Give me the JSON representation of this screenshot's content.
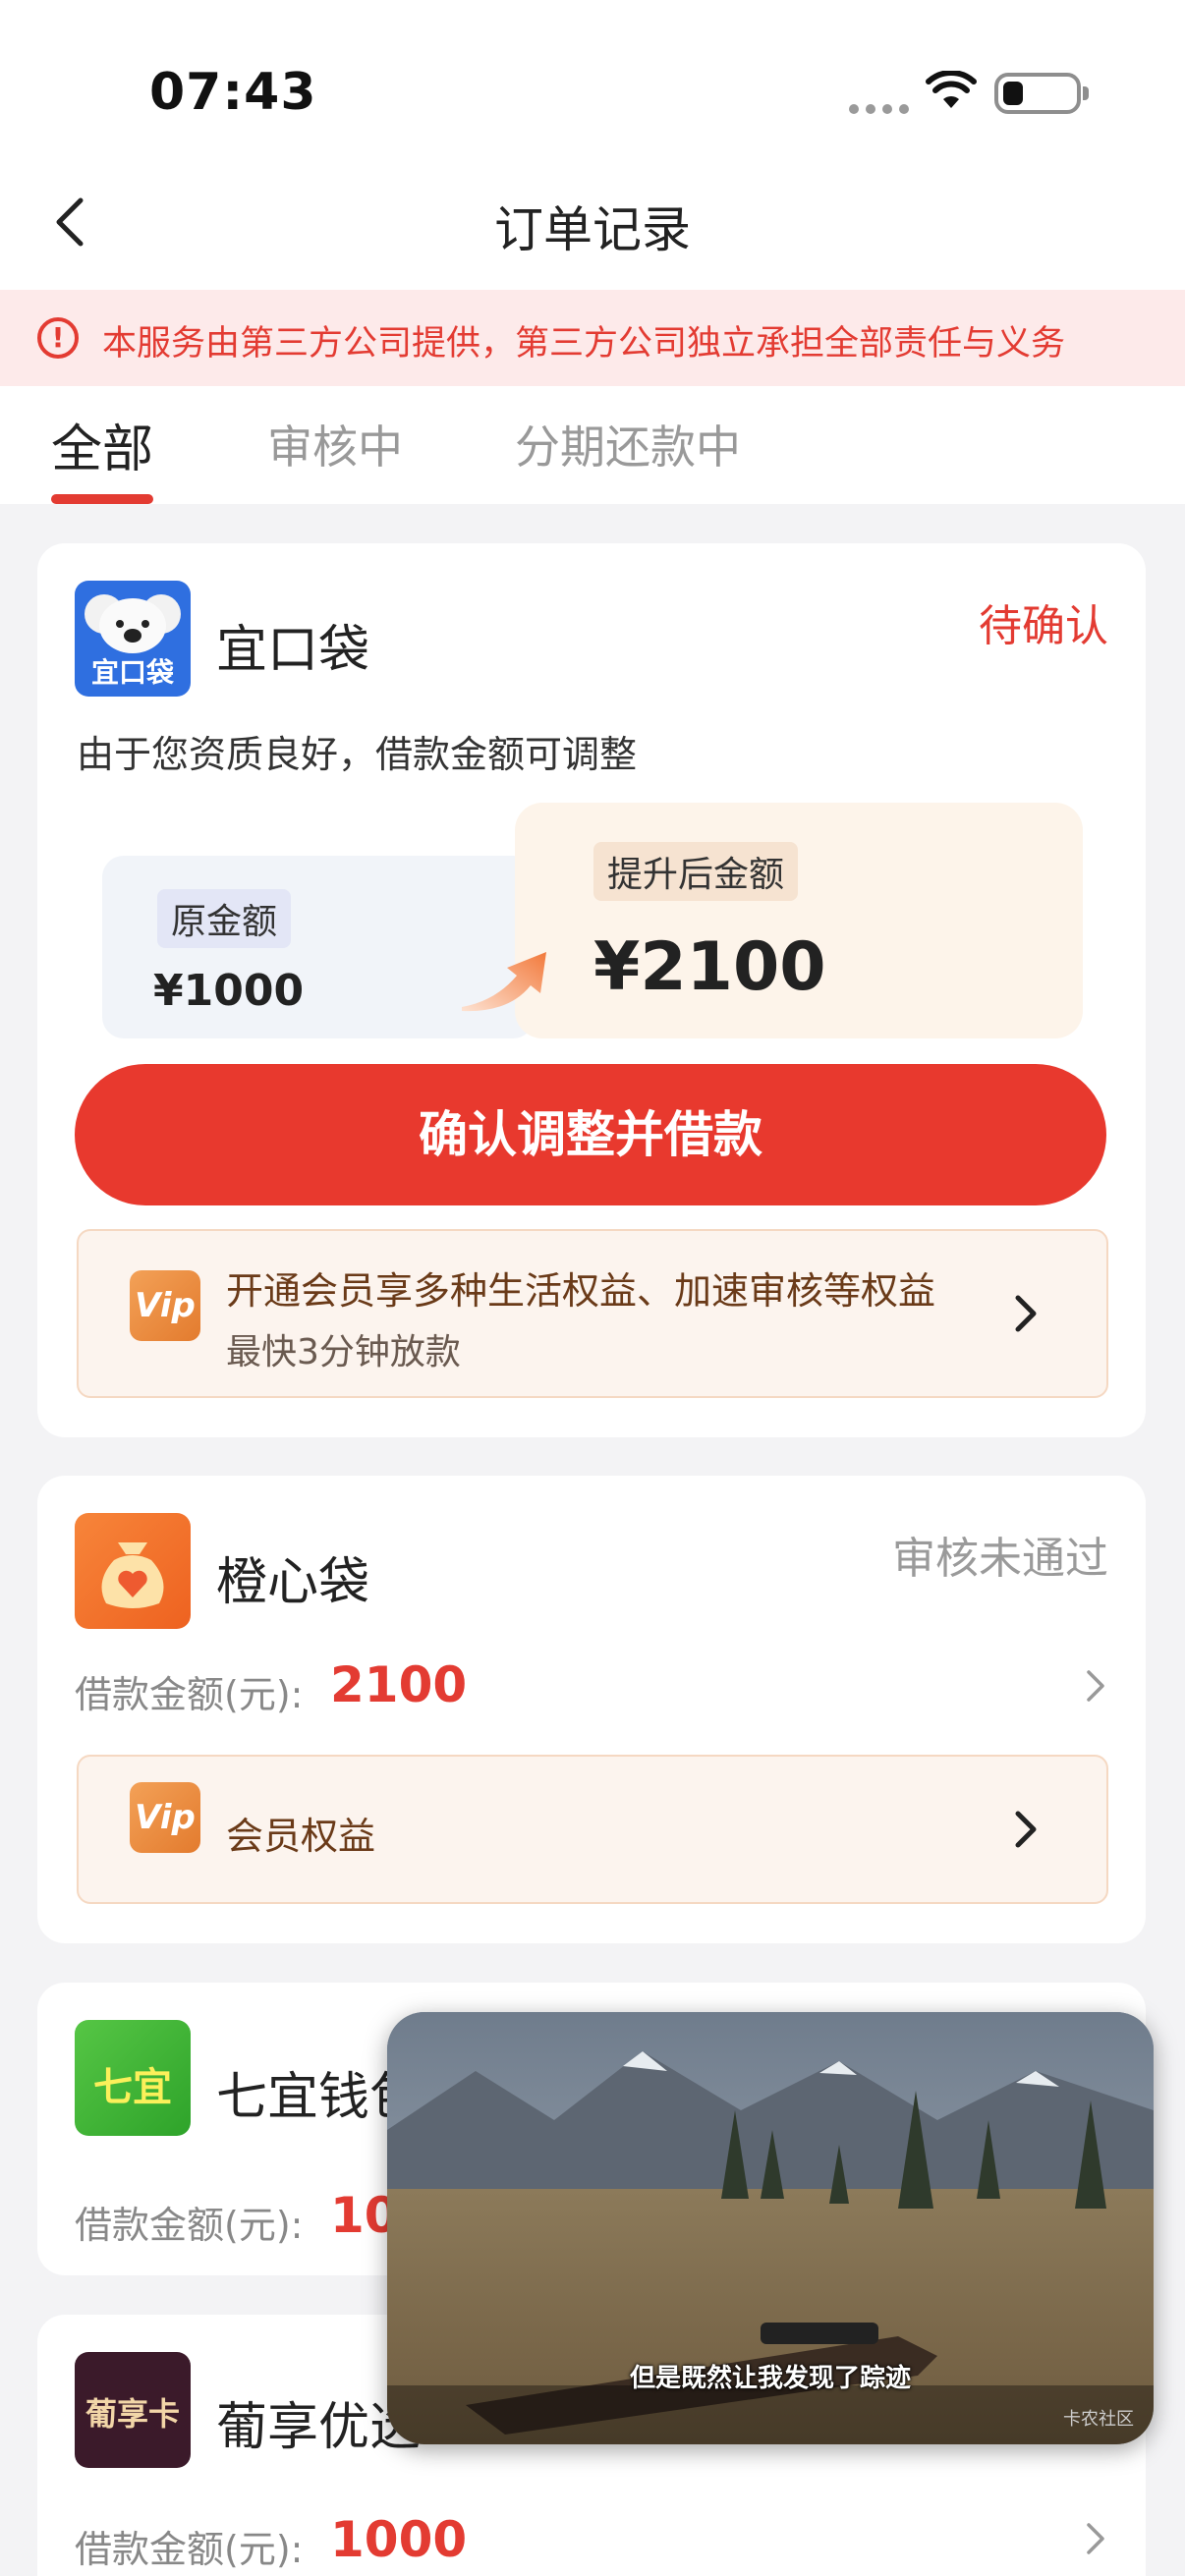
{
  "status_bar": {
    "time": "07:43"
  },
  "header": {
    "title": "订单记录"
  },
  "notice": {
    "text": "本服务由第三方公司提供，第三方公司独立承担全部责任与义务"
  },
  "tabs": [
    {
      "label": "全部",
      "active": true
    },
    {
      "label": "审核中",
      "active": false
    },
    {
      "label": "分期还款中",
      "active": false
    }
  ],
  "orders": [
    {
      "name": "宜口袋",
      "logo_text": "宜口袋",
      "status": "待确认",
      "desc": "由于您资质良好，借款金额可调整",
      "original_label": "原金额",
      "original_amount": "¥1000",
      "raised_label": "提升后金额",
      "raised_amount": "¥2100",
      "confirm_button": "确认调整并借款",
      "vip_title": "开通会员享多种生活权益、加速审核等权益",
      "vip_subtitle": "最快3分钟放款",
      "vip_badge": "Vip"
    },
    {
      "name": "橙心袋",
      "status": "审核未通过",
      "amount_label": "借款金额(元):",
      "amount": "2100",
      "vip_title": "会员权益",
      "vip_badge": "Vip"
    },
    {
      "name": "七宜钱包",
      "logo_text": "七宜",
      "amount_label": "借款金额(元):",
      "amount": "1000"
    },
    {
      "name": "葡享优选",
      "logo_text": "葡享卡",
      "amount_label": "借款金额(元):",
      "amount": "1000"
    }
  ],
  "floating_video": {
    "subtitle": "但是既然让我发现了踪迹",
    "watermark": "卡农社区"
  },
  "colors": {
    "accent": "#e8392e",
    "notice_bg": "#fdeaea",
    "vip_bg": "#fcf4ee"
  }
}
